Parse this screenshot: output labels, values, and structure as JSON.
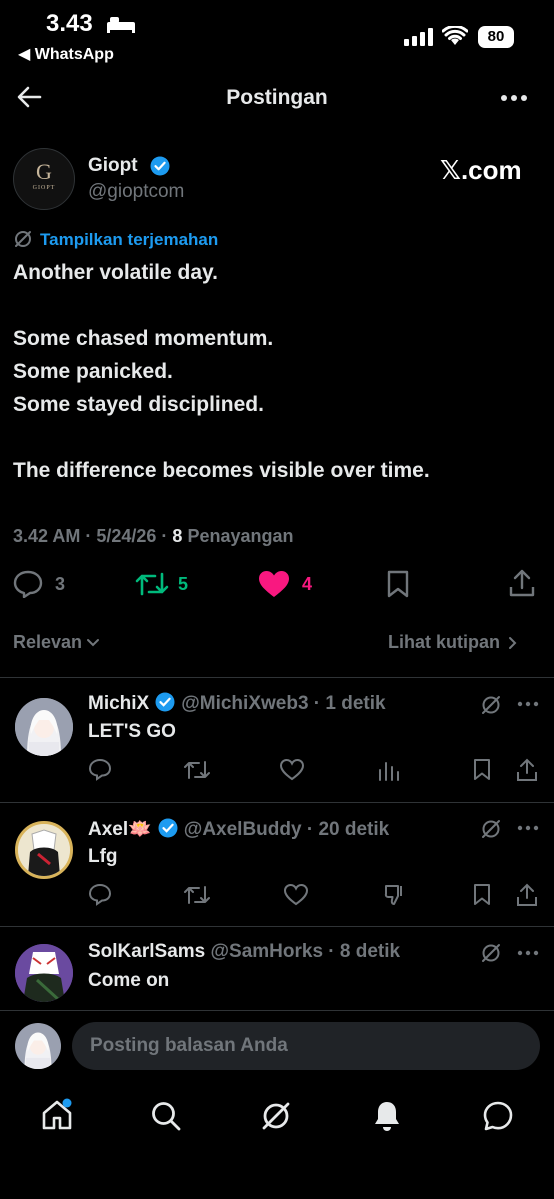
{
  "status_bar": {
    "time": "3.43",
    "back_app": "◀ WhatsApp",
    "battery": "80"
  },
  "header": {
    "title": "Postingan"
  },
  "post": {
    "author_name": "Giopt",
    "author_handle": "@gioptcom",
    "avatar_letter": "G",
    "avatar_text": "GIOPT",
    "site_label": "𝕏.com",
    "translate_label": "Tampilkan terjemahan",
    "lines": [
      "Another volatile day.",
      "Some chased momentum.",
      "Some panicked.",
      "Some stayed disciplined.",
      "The difference becomes visible over time."
    ],
    "time_date": "3.42 AM · 5/24/26 · ",
    "views_count": "8",
    "views_label": " Penayangan",
    "replies": "3",
    "reposts": "5",
    "likes": "4"
  },
  "sort": {
    "label": "Relevan",
    "quotes_label": "Lihat kutipan"
  },
  "replies": [
    {
      "name": "MichiX",
      "handle": "@MichiXweb3 · 1 detik",
      "text": "LET'S GO"
    },
    {
      "name": "Axel🪷",
      "handle": "@AxelBuddy · 20 detik",
      "text": "Lfg"
    },
    {
      "name": "SolKarlSams",
      "handle": "@SamHorks · 8 detik",
      "text": "Come on"
    }
  ],
  "composer": {
    "placeholder": "Posting balasan Anda"
  },
  "colors": {
    "accent": "#1d9bf0",
    "repost": "#00ba7c",
    "like": "#f91880",
    "muted": "#71767b"
  }
}
